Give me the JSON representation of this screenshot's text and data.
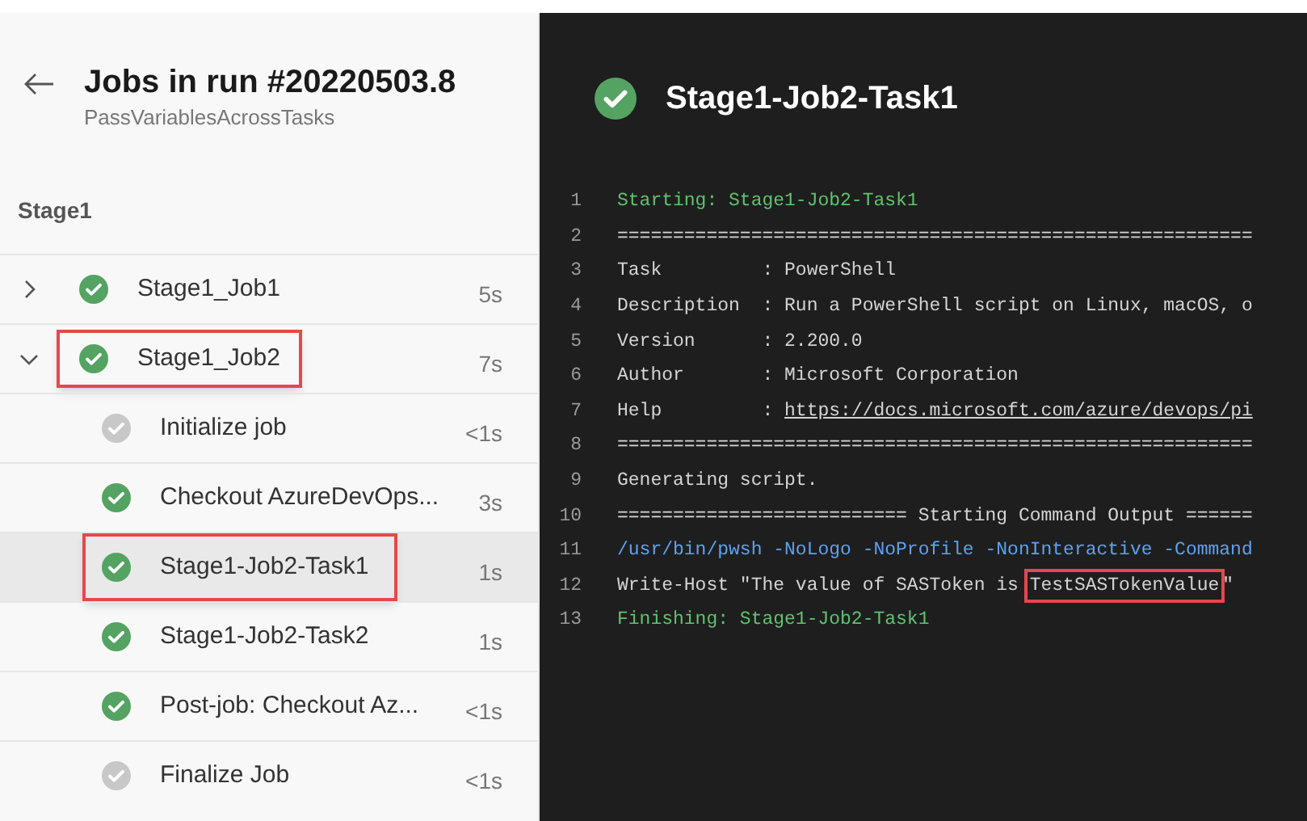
{
  "sidebar": {
    "title": "Jobs in run #20220503.8",
    "subtitle": "PassVariablesAcrossTasks",
    "stage": "Stage1",
    "jobs": [
      {
        "name": "Stage1_Job1",
        "duration": "5s",
        "skipped": false,
        "expanded": false,
        "highlighted": false
      },
      {
        "name": "Stage1_Job2",
        "duration": "7s",
        "skipped": false,
        "expanded": true,
        "highlighted": true,
        "children": [
          {
            "name": "Initialize job",
            "duration": "<1s",
            "skipped": true,
            "selected": false,
            "highlighted": false
          },
          {
            "name": "Checkout AzureDevOps...",
            "duration": "3s",
            "skipped": false,
            "selected": false,
            "highlighted": false
          },
          {
            "name": "Stage1-Job2-Task1",
            "duration": "1s",
            "skipped": false,
            "selected": true,
            "highlighted": true
          },
          {
            "name": "Stage1-Job2-Task2",
            "duration": "1s",
            "skipped": false,
            "selected": false,
            "highlighted": false
          },
          {
            "name": "Post-job: Checkout Az...",
            "duration": "<1s",
            "skipped": false,
            "selected": false,
            "highlighted": false
          },
          {
            "name": "Finalize Job",
            "duration": "<1s",
            "skipped": true,
            "selected": false,
            "highlighted": false
          }
        ]
      }
    ]
  },
  "log": {
    "title": "Stage1-Job2-Task1",
    "skipped": false,
    "lines": [
      {
        "number": "1",
        "kind": "section",
        "text": "Starting: Stage1-Job2-Task1"
      },
      {
        "number": "2",
        "kind": "plain",
        "text": "========================================================="
      },
      {
        "number": "3",
        "kind": "plain",
        "text": "Task         : PowerShell"
      },
      {
        "number": "4",
        "kind": "plain",
        "text": "Description  : Run a PowerShell script on Linux, macOS, o"
      },
      {
        "number": "5",
        "kind": "plain",
        "text": "Version      : 2.200.0"
      },
      {
        "number": "6",
        "kind": "plain",
        "text": "Author       : Microsoft Corporation"
      },
      {
        "number": "7",
        "kind": "plain",
        "text": "Help         : ",
        "link": "https://docs.microsoft.com/azure/devops/pi"
      },
      {
        "number": "8",
        "kind": "plain",
        "text": "========================================================="
      },
      {
        "number": "9",
        "kind": "plain",
        "text": "Generating script."
      },
      {
        "number": "10",
        "kind": "plain",
        "text": "========================== Starting Command Output ======"
      },
      {
        "number": "11",
        "kind": "command",
        "text": "/usr/bin/pwsh -NoLogo -NoProfile -NonInteractive -Command"
      },
      {
        "number": "12",
        "kind": "plain",
        "text": "Write-Host \"The value of SASToken is ",
        "highlight": "TestSASTokenValue",
        "suffix": "\""
      },
      {
        "number": "13",
        "kind": "section",
        "text": "Finishing: Stage1-Job2-Task1"
      }
    ]
  }
}
